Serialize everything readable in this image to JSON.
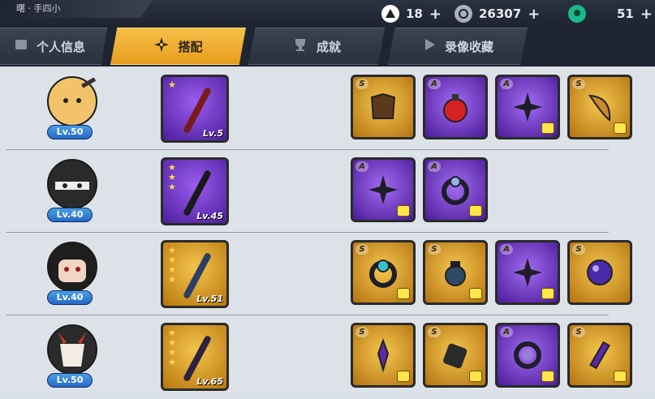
{
  "topbar": {
    "title": "曙 · 手四小",
    "resources": [
      {
        "icon": "onigiri-icon",
        "value": "18",
        "color": "#ffffff"
      },
      {
        "icon": "coin-icon",
        "value": "26307",
        "color": "#a8b0bb"
      },
      {
        "icon": "jade-icon",
        "value": "51",
        "color": "#19b98c"
      }
    ]
  },
  "tabs": [
    {
      "label": "个人信息",
      "icon": "profile-icon",
      "active": false
    },
    {
      "label": "搭配",
      "icon": "shuriken-icon",
      "active": true
    },
    {
      "label": "成就",
      "icon": "trophy-icon",
      "active": false
    },
    {
      "label": "录像收藏",
      "icon": "play-icon",
      "active": false
    }
  ],
  "rows": [
    {
      "character": {
        "icon": "orange-ninja-icon",
        "level": "Lv.50"
      },
      "weapon": {
        "rarity": "purple",
        "stars": 1,
        "level": "Lv.5",
        "icon": "staff-icon"
      },
      "items": [
        {
          "grade": "S",
          "rarity": "gold",
          "icon": "armor-icon"
        },
        {
          "grade": "A",
          "rarity": "purple",
          "icon": "potion-icon"
        },
        {
          "grade": "A",
          "rarity": "purple",
          "icon": "shuriken-icon"
        },
        {
          "grade": "S",
          "rarity": "gold",
          "icon": "horn-icon"
        }
      ]
    },
    {
      "character": {
        "icon": "masked-ninja-icon",
        "level": "Lv.40"
      },
      "weapon": {
        "rarity": "purple",
        "stars": 3,
        "level": "Lv.45",
        "icon": "spear-icon"
      },
      "items": [
        {
          "grade": "A",
          "rarity": "purple",
          "icon": "shuriken-icon"
        },
        {
          "grade": "A",
          "rarity": "purple",
          "icon": "ring-icon"
        }
      ]
    },
    {
      "character": {
        "icon": "black-hair-ninja-icon",
        "level": "Lv.40"
      },
      "weapon": {
        "rarity": "gold",
        "stars": 4,
        "level": "Lv.51",
        "icon": "trident-icon"
      },
      "items": [
        {
          "grade": "S",
          "rarity": "gold",
          "icon": "ring-icon"
        },
        {
          "grade": "S",
          "rarity": "gold",
          "icon": "lantern-icon"
        },
        {
          "grade": "A",
          "rarity": "purple",
          "icon": "shuriken-icon"
        },
        {
          "grade": "S",
          "rarity": "gold",
          "icon": "orb-icon"
        }
      ]
    },
    {
      "character": {
        "icon": "oni-mask-ninja-icon",
        "level": "Lv.50"
      },
      "weapon": {
        "rarity": "gold",
        "stars": 4,
        "level": "Lv.65",
        "icon": "scythe-icon"
      },
      "items": [
        {
          "grade": "S",
          "rarity": "gold",
          "icon": "kunai-icon"
        },
        {
          "grade": "S",
          "rarity": "gold",
          "icon": "scroll-icon"
        },
        {
          "grade": "A",
          "rarity": "purple",
          "icon": "ring-icon"
        },
        {
          "grade": "S",
          "rarity": "gold",
          "icon": "blade-icon"
        }
      ]
    }
  ]
}
